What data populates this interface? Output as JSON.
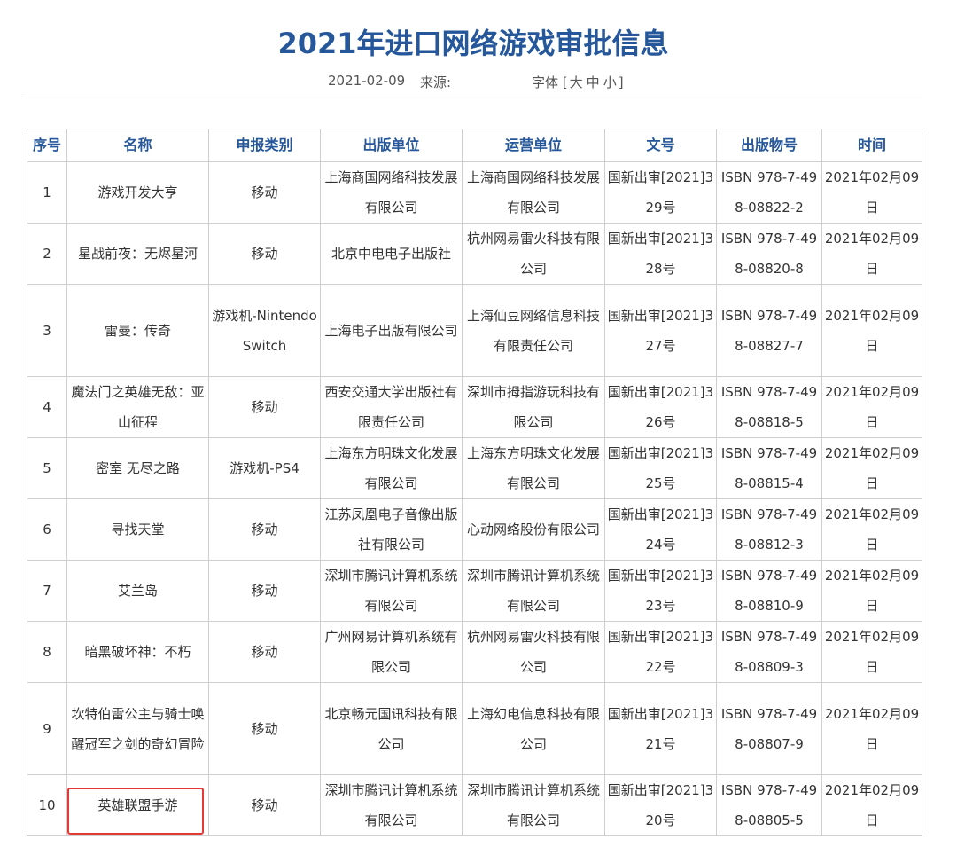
{
  "article": {
    "title": "2021年进口网络游戏审批信息",
    "date": "2021-02-09",
    "source_label": "来源:",
    "font_label": "字体",
    "font_open": "[",
    "font_large": "大",
    "font_medium": "中",
    "font_small": "小",
    "font_close": "]"
  },
  "table": {
    "headers": [
      "序号",
      "名称",
      "申报类别",
      "出版单位",
      "运营单位",
      "文号",
      "出版物号",
      "时间"
    ],
    "rows": [
      [
        "1",
        "游戏开发大亨",
        "移动",
        "上海商国网络科技发展有限公司",
        "上海商国网络科技发展有限公司",
        "国新出审[2021]329号",
        "ISBN 978-7-498-08822-2",
        "2021年02月09日"
      ],
      [
        "2",
        "星战前夜：无烬星河",
        "移动",
        "北京中电电子出版社",
        "杭州网易雷火科技有限公司",
        "国新出审[2021]328号",
        "ISBN 978-7-498-08820-8",
        "2021年02月09日"
      ],
      [
        "3",
        "雷曼：传奇",
        "游戏机-Nintendo Switch",
        "上海电子出版有限公司",
        "上海仙豆网络信息科技有限责任公司",
        "国新出审[2021]327号",
        "ISBN 978-7-498-08827-7",
        "2021年02月09日"
      ],
      [
        "4",
        "魔法门之英雄无敌：亚山征程",
        "移动",
        "西安交通大学出版社有限责任公司",
        "深圳市拇指游玩科技有限公司",
        "国新出审[2021]326号",
        "ISBN 978-7-498-08818-5",
        "2021年02月09日"
      ],
      [
        "5",
        "密室 无尽之路",
        "游戏机-PS4",
        "上海东方明珠文化发展有限公司",
        "上海东方明珠文化发展有限公司",
        "国新出审[2021]325号",
        "ISBN 978-7-498-08815-4",
        "2021年02月09日"
      ],
      [
        "6",
        "寻找天堂",
        "移动",
        "江苏凤凰电子音像出版社有限公司",
        "心动网络股份有限公司",
        "国新出审[2021]324号",
        "ISBN 978-7-498-08812-3",
        "2021年02月09日"
      ],
      [
        "7",
        "艾兰岛",
        "移动",
        "深圳市腾讯计算机系统有限公司",
        "深圳市腾讯计算机系统有限公司",
        "国新出审[2021]323号",
        "ISBN 978-7-498-08810-9",
        "2021年02月09日"
      ],
      [
        "8",
        "暗黑破坏神：不朽",
        "移动",
        "广州网易计算机系统有限公司",
        "杭州网易雷火科技有限公司",
        "国新出审[2021]322号",
        "ISBN 978-7-498-08809-3",
        "2021年02月09日"
      ],
      [
        "9",
        "坎特伯雷公主与骑士唤醒冠军之剑的奇幻冒险",
        "移动",
        "北京畅元国讯科技有限公司",
        "上海幻电信息科技有限公司",
        "国新出审[2021]321号",
        "ISBN 978-7-498-08807-9",
        "2021年02月09日"
      ],
      [
        "10",
        "英雄联盟手游",
        "移动",
        "深圳市腾讯计算机系统有限公司",
        "深圳市腾讯计算机系统有限公司",
        "国新出审[2021]320号",
        "ISBN 978-7-498-08805-5",
        "2021年02月09日"
      ]
    ]
  },
  "colors": {
    "title": "#25579a",
    "header_text": "#25579a",
    "border": "#cfcfcf",
    "highlight": "#e53935"
  }
}
